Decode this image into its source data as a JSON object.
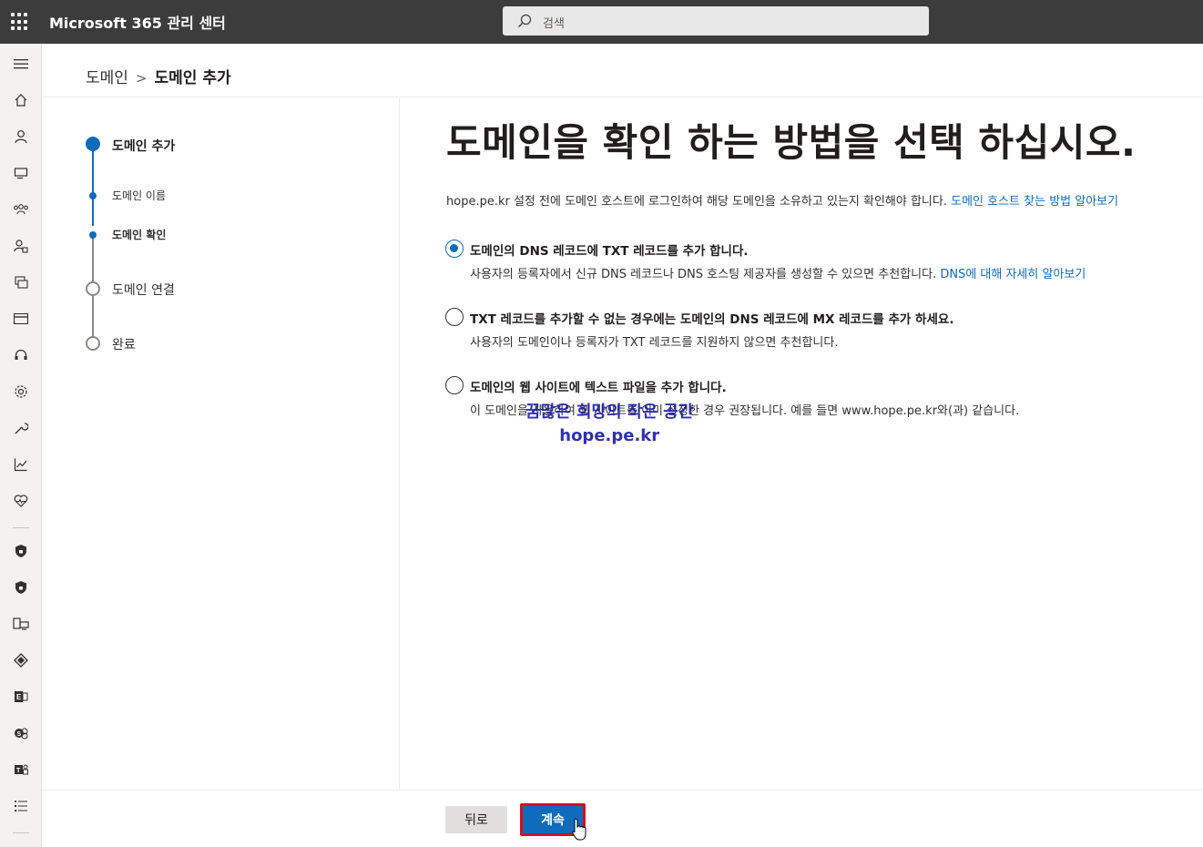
{
  "header": {
    "app_title": "Microsoft 365 관리 센터",
    "search_placeholder": "검색"
  },
  "breadcrumb": {
    "root": "도메인",
    "separator": ">",
    "current": "도메인 추가"
  },
  "stepper": {
    "steps": [
      {
        "label": "도메인 추가",
        "state": "current"
      },
      {
        "label": "도메인 이름",
        "state": "sub-done"
      },
      {
        "label": "도메인 확인",
        "state": "sub-current"
      },
      {
        "label": "도메인 연결",
        "state": "pending"
      },
      {
        "label": "완료",
        "state": "pending"
      }
    ]
  },
  "main": {
    "title": "도메인을 확인 하는 방법을 선택 하십시오.",
    "description": "hope.pe.kr 설정 전에 도메인 호스트에 로그인하여 해당 도메인을 소유하고 있는지 확인해야 합니다.",
    "description_link": "도메인 호스트 찾는 방법 알아보기",
    "options": [
      {
        "title": "도메인의 DNS 레코드에 TXT 레코드를 추가 합니다.",
        "desc": "사용자의 등록자에서 신규 DNS 레코드나 DNS 호스팅 제공자를 생성할 수 있으면 추천합니다.",
        "link": "DNS에 대해 자세히 알아보기",
        "selected": true
      },
      {
        "title": "TXT 레코드를 추가할 수 없는 경우에는 도메인의 DNS 레코드에 MX 레코드를 추가 하세요.",
        "desc": "사용자의 도메인이나 등록자가 TXT 레코드를 지원하지 않으면 추천합니다.",
        "link": "",
        "selected": false
      },
      {
        "title": "도메인의 웹 사이트에 텍스트 파일을 추가 합니다.",
        "desc": "이 도메인을 사용하여 웹 사이트를 이미 설정한 경우 권장됩니다. 예를 들면 www.hope.pe.kr와(과) 같습니다.",
        "link": "",
        "selected": false
      }
    ]
  },
  "watermark": {
    "line1": "꿈많은 희망의 작은 공간",
    "line2": "hope.pe.kr"
  },
  "footer": {
    "back_label": "뒤로",
    "next_label": "계속"
  },
  "colors": {
    "accent": "#0f6cbd",
    "topbar": "#3c3c3c",
    "highlight": "#d40f1e"
  },
  "rail_icons": [
    "menu-icon",
    "home-icon",
    "user-icon",
    "devices-icon",
    "teams-icon",
    "roles-icon",
    "resources-icon",
    "billing-icon",
    "support-icon",
    "settings-icon",
    "setup-icon",
    "reports-icon",
    "health-icon",
    "security-icon",
    "compliance-icon",
    "endpoint-icon",
    "azure-ad-icon",
    "exchange-icon",
    "sharepoint-icon",
    "teams-admin-icon",
    "all-admin-centers-icon"
  ]
}
